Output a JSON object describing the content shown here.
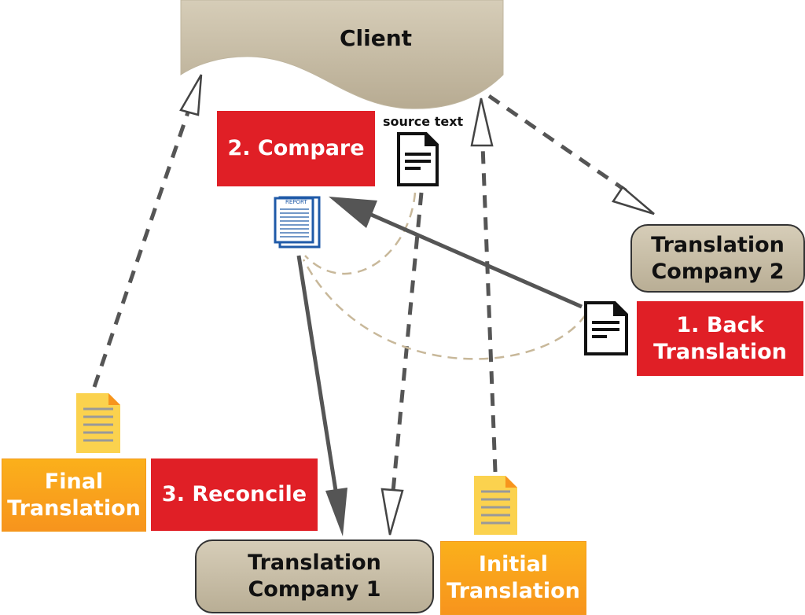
{
  "nodes": {
    "client": "Client",
    "compare": "2. Compare",
    "source_text": "source text",
    "report_label": "REPORT",
    "company2": [
      "Translation",
      "Company 2"
    ],
    "back_translation": [
      "1. Back",
      "Translation"
    ],
    "final_translation": [
      "Final",
      "Translation"
    ],
    "reconcile": "3. Reconcile",
    "company1": [
      "Translation",
      "Company 1"
    ],
    "initial_translation": [
      "Initial",
      "Translation"
    ]
  },
  "colors": {
    "red": "#e01f26",
    "orange": "#f7941d",
    "tan": "#c8bea6",
    "arrow": "#555555",
    "curve": "#c8b89a"
  }
}
